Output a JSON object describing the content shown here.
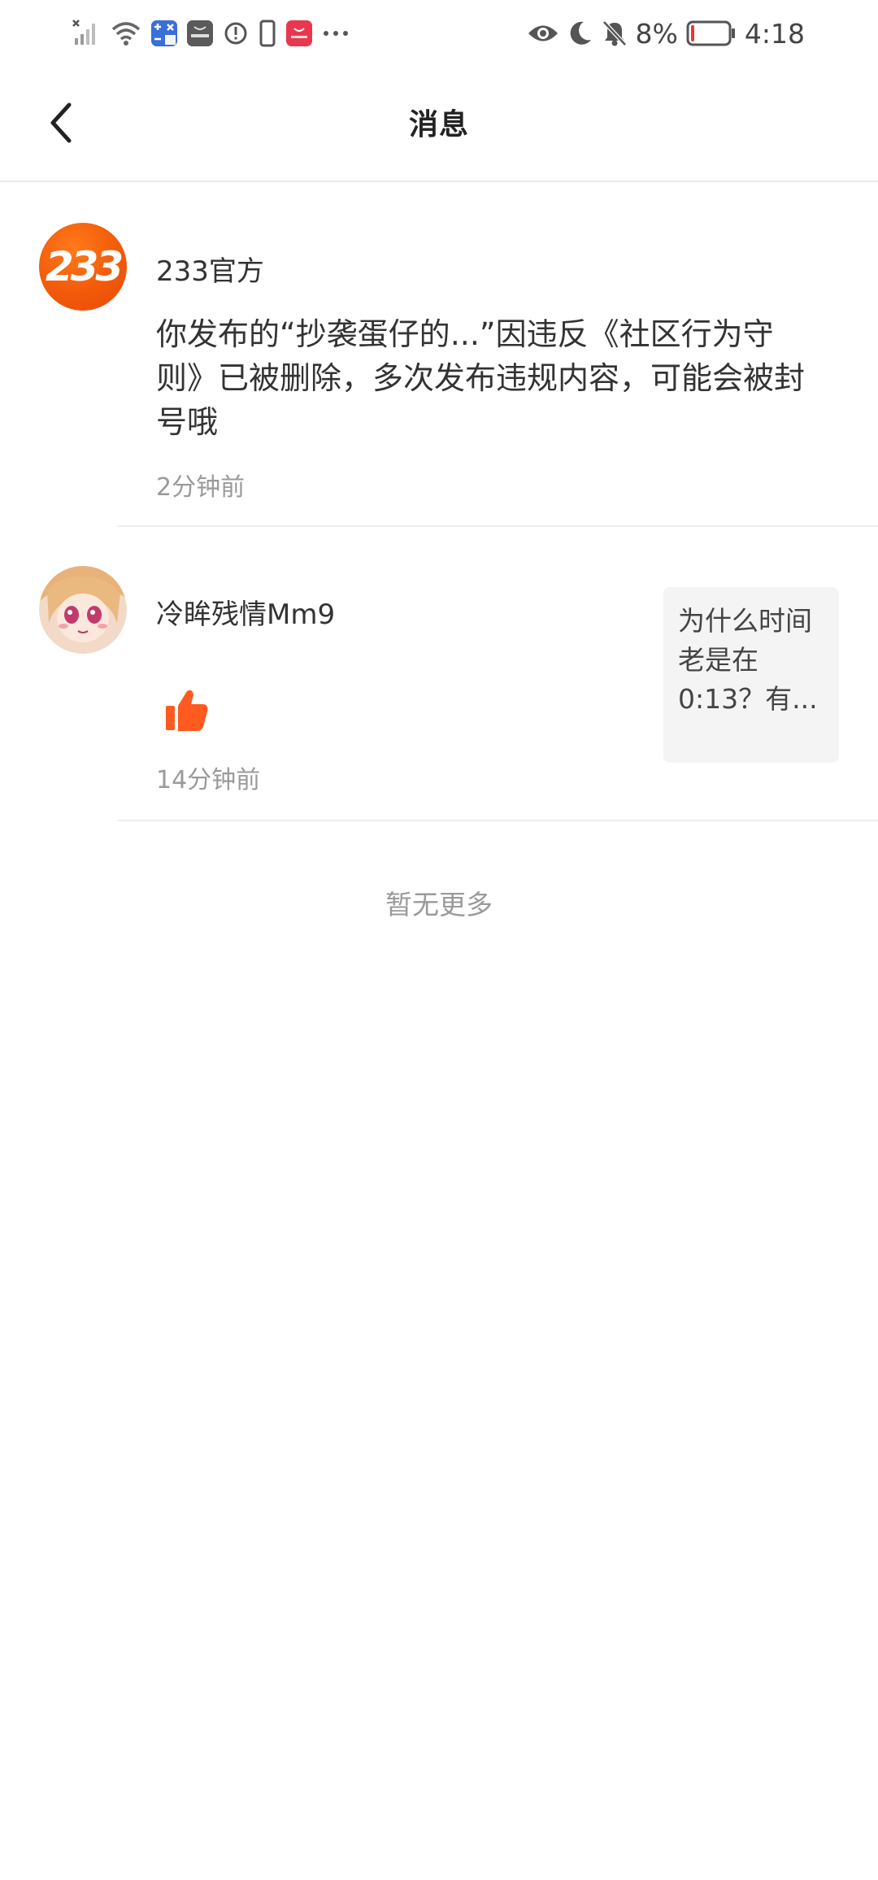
{
  "status_bar": {
    "battery_percent": "8%",
    "time": "4:18",
    "left_icons": [
      "signal-off-icon",
      "wifi-icon",
      "calculator-app-icon",
      "huawei-app-icon",
      "alert-icon",
      "phone-icon",
      "huawei-store-icon",
      "more-dots-icon"
    ],
    "right_icons": [
      "eye-icon",
      "moon-icon",
      "bell-off-icon",
      "battery-low-icon"
    ],
    "battery_level": 0.08,
    "battery_color": "#e53935"
  },
  "header": {
    "title": "消息",
    "back_icon": "chevron-left-icon"
  },
  "messages": [
    {
      "sender": "233官方",
      "avatar_text": "233",
      "avatar_color": "#f25a0a",
      "body": "你发布的“抄袭蛋仔的...”因违反《社区行为守则》已被删除，多次发布违规内容，可能会被封号哦",
      "time": "2分钟前"
    },
    {
      "sender": "冷眸残情Mm9",
      "avatar": "anime-girl-avatar",
      "action_icon": "thumbs-up-icon",
      "action_color": "#ff5a1f",
      "time": "14分钟前",
      "quote": "为什么时间老是在0:13？有..."
    }
  ],
  "footer": {
    "no_more": "暂无更多"
  }
}
